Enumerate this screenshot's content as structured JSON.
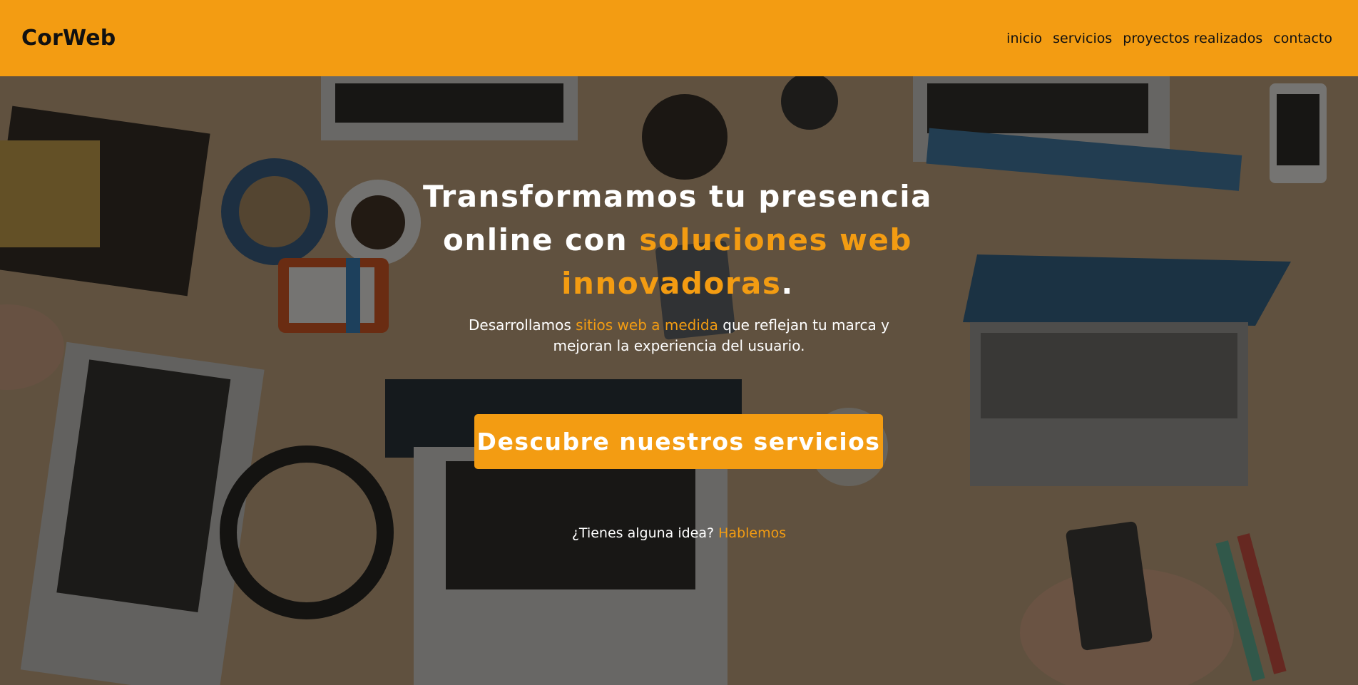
{
  "header": {
    "logo": "CorWeb",
    "nav": [
      "inicio",
      "servicios",
      "proyectos realizados",
      "contacto"
    ]
  },
  "hero": {
    "background": "top-down-photo-of-desk-with-laptops",
    "headline_part1": "Transformamos tu presencia online con ",
    "headline_accent": "soluciones web innovadoras",
    "headline_end": ".",
    "sub_part1": "Desarrollamos ",
    "sub_accent": "sitios web a medida",
    "sub_part2": " que reflejan tu marca y mejoran la experiencia del usuario.",
    "cta_label": "Descubre nuestros servicios",
    "idea_text": "¿Tienes alguna idea? ",
    "idea_link": "Hablemos"
  },
  "colors": {
    "accent": "#f39c12",
    "header_text": "#111111",
    "hero_text": "#ffffff"
  }
}
